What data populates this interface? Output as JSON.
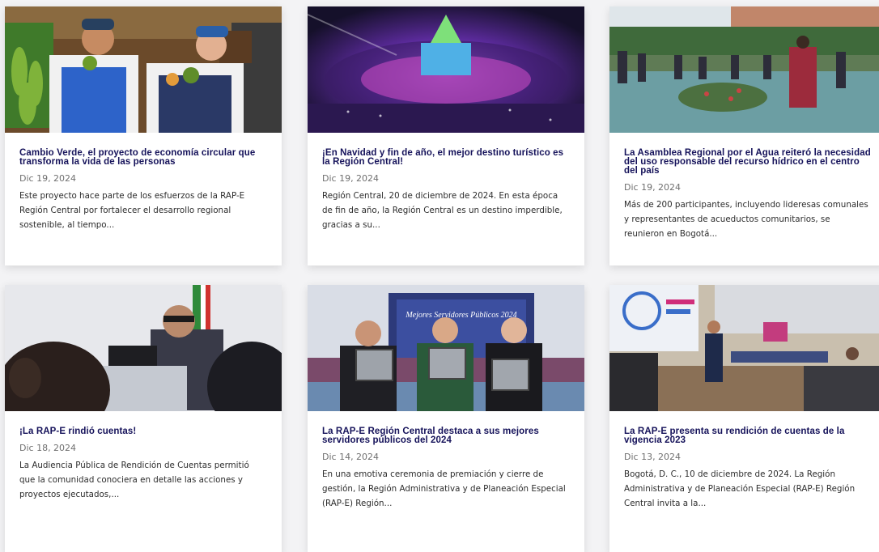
{
  "posts": [
    {
      "title": "Cambio Verde, el proyecto de economía circular que transforma la vida de las personas",
      "date": "Dic 19, 2024",
      "excerpt": "Este proyecto hace parte de los esfuerzos de la RAP-E Región Central por fortalecer el desarrollo regional sostenible, al tiempo..."
    },
    {
      "title": "¡En Navidad y fin de año, el mejor destino turístico es la Región Central!",
      "date": "Dic 19, 2024",
      "excerpt": "Región Central, 20 de diciembre de 2024. En esta época de fin de año, la Región Central es un destino imperdible, gracias a su..."
    },
    {
      "title": "La Asamblea Regional por el Agua reiteró la necesidad del uso responsable del recurso hídrico en el centro del país",
      "date": "Dic 19, 2024",
      "excerpt": "Más de 200 participantes, incluyendo lideresas comunales y representantes de acueductos comunitarios, se reunieron en Bogotá..."
    },
    {
      "title": "¡La RAP-E rindió cuentas!",
      "date": "Dic 18, 2024",
      "excerpt": "La Audiencia Pública de Rendición de Cuentas permitió que la comunidad conociera en detalle las acciones y proyectos ejecutados,..."
    },
    {
      "title": "La RAP-E Región Central destaca a sus mejores servidores públicos del 2024",
      "date": "Dic 14, 2024",
      "excerpt": "En una emotiva ceremonia de premiación y cierre de gestión, la Región Administrativa y de Planeación Especial (RAP-E) Región..."
    },
    {
      "title": "La RAP-E presenta su rendición de cuentas de la vigencia 2023",
      "date": "Dic 13, 2024",
      "excerpt": "Bogotá, D. C., 10 de diciembre de 2024. La Región Administrativa y de Planeación Especial (RAP-E) Región Central invita a la..."
    }
  ],
  "images": {
    "photo2_text": "Mejores Servidores Públicos 2024"
  },
  "colors": {
    "title": "#15125a",
    "date": "#6f6f6f",
    "excerpt": "#2d2d2d",
    "background": "#f3f3f5"
  }
}
